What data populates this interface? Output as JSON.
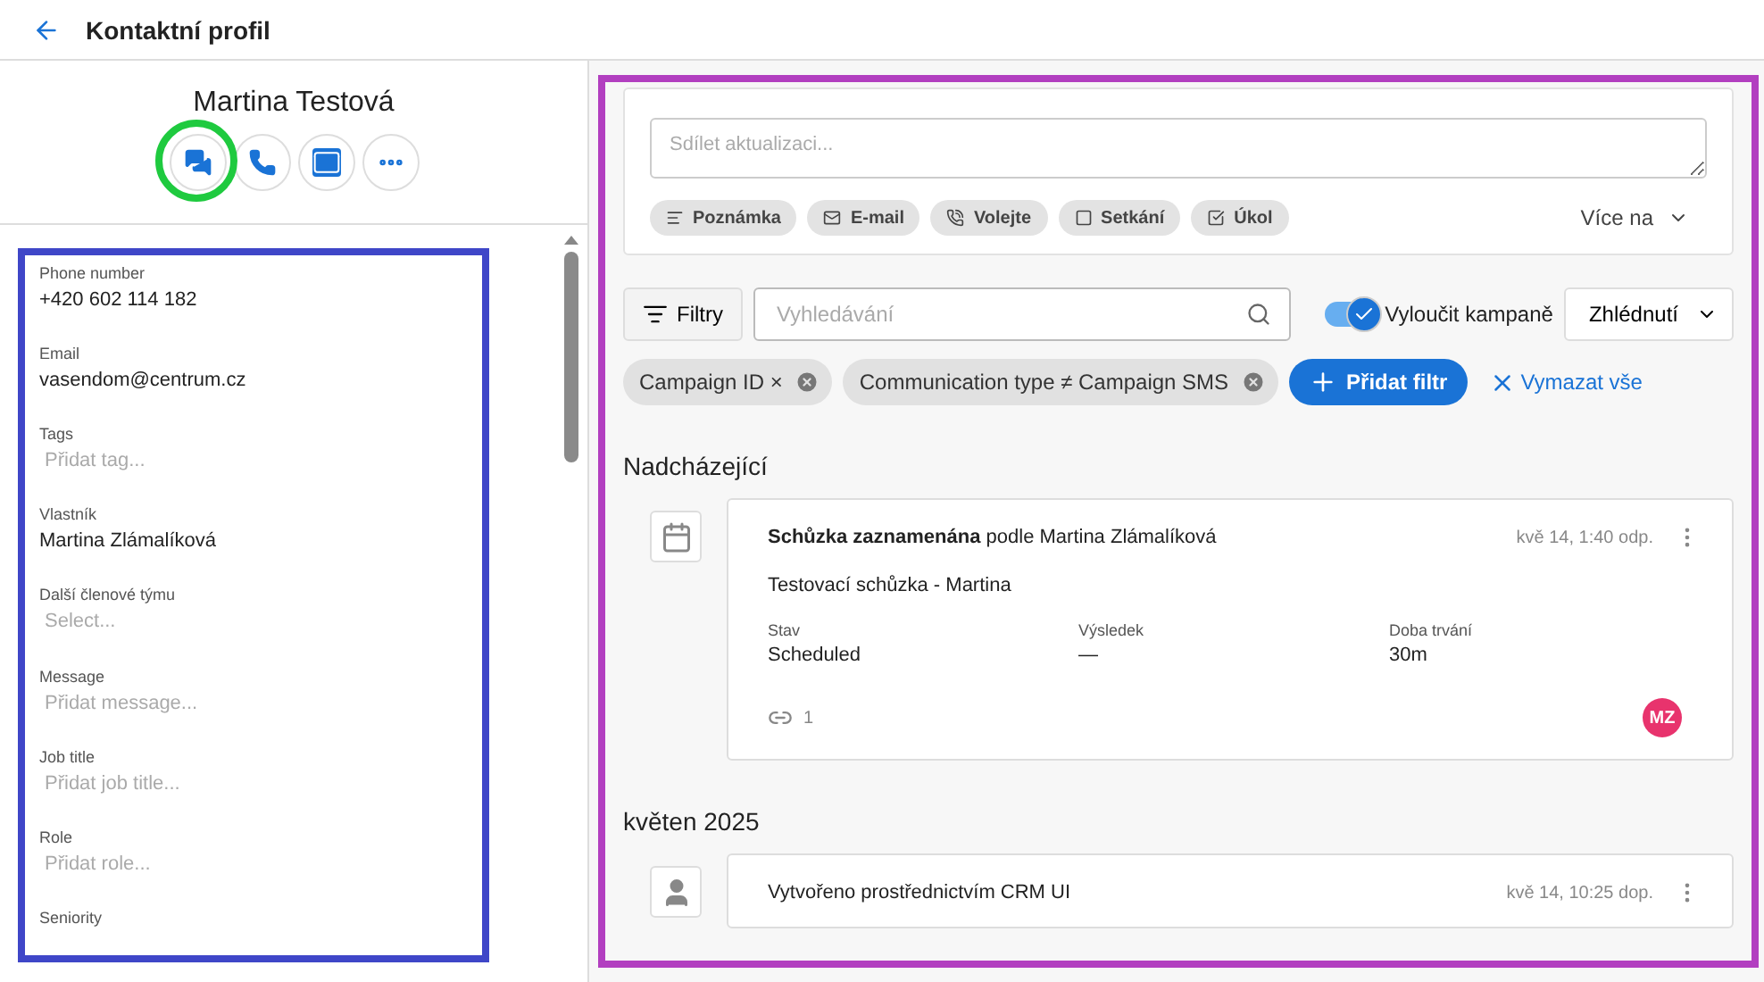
{
  "header": {
    "title": "Kontaktní profil"
  },
  "contact": {
    "name": "Martina Testová",
    "actions": [
      {
        "kind": "chat"
      },
      {
        "kind": "phone"
      },
      {
        "kind": "email"
      },
      {
        "kind": "more"
      }
    ]
  },
  "fields": [
    {
      "label": "Phone number",
      "value": "+420 602 114 182"
    },
    {
      "label": "Email",
      "value": "vasendom@centrum.cz"
    },
    {
      "label": "Tags",
      "placeholder": "Přidat tag..."
    },
    {
      "label": "Vlastník",
      "value": "Martina Zlámalíková"
    },
    {
      "label": "Další členové týmu",
      "placeholder": "Select..."
    },
    {
      "label": "Message",
      "placeholder": "Přidat message..."
    },
    {
      "label": "Job title",
      "placeholder": "Přidat job title..."
    },
    {
      "label": "Role",
      "placeholder": "Přidat role..."
    },
    {
      "label": "Seniority"
    }
  ],
  "composer": {
    "placeholder": "Sdílet aktualizaci...",
    "chips": [
      {
        "kind": "note",
        "label": "Poznámka"
      },
      {
        "kind": "email",
        "label": "E-mail"
      },
      {
        "kind": "call",
        "label": "Volejte"
      },
      {
        "kind": "meeting",
        "label": "Setkání"
      },
      {
        "kind": "task",
        "label": "Úkol"
      }
    ],
    "more": "Více na"
  },
  "toolbar": {
    "filter_button": "Filtry",
    "search_placeholder": "Vyhledávání",
    "toggle": {
      "label": "Vyloučit kampaně",
      "on": true
    },
    "sort": "Zhlédnutí"
  },
  "active_filters": [
    {
      "label": "Campaign ID ×"
    },
    {
      "label": "Communication type ≠ Campaign SMS"
    }
  ],
  "add_filter": "Přidat filtr",
  "clear_all": "Vymazat vše",
  "sections": [
    {
      "title": "Nadcházející",
      "items": [
        {
          "kind": "meeting",
          "title": "**Schůzka zaznamenána** podle Martina Zlámalíková",
          "time": "kvě 14, 1:40 odp.",
          "description": "Testovací schůzka - Martina",
          "stats": [
            {
              "label": "Stav",
              "value": "Scheduled"
            },
            {
              "label": "Výsledek",
              "value": "—"
            },
            {
              "label": "Doba trvání",
              "value": "30m"
            }
          ],
          "links": "1",
          "avatar": {
            "initials": "MZ",
            "color": "#e8336d"
          }
        }
      ]
    },
    {
      "title": "květen 2025",
      "items": [
        {
          "kind": "created",
          "title": "Vytvořeno prostřednictvím CRM UI",
          "time": "kvě 14, 10:25 dop."
        }
      ]
    }
  ]
}
